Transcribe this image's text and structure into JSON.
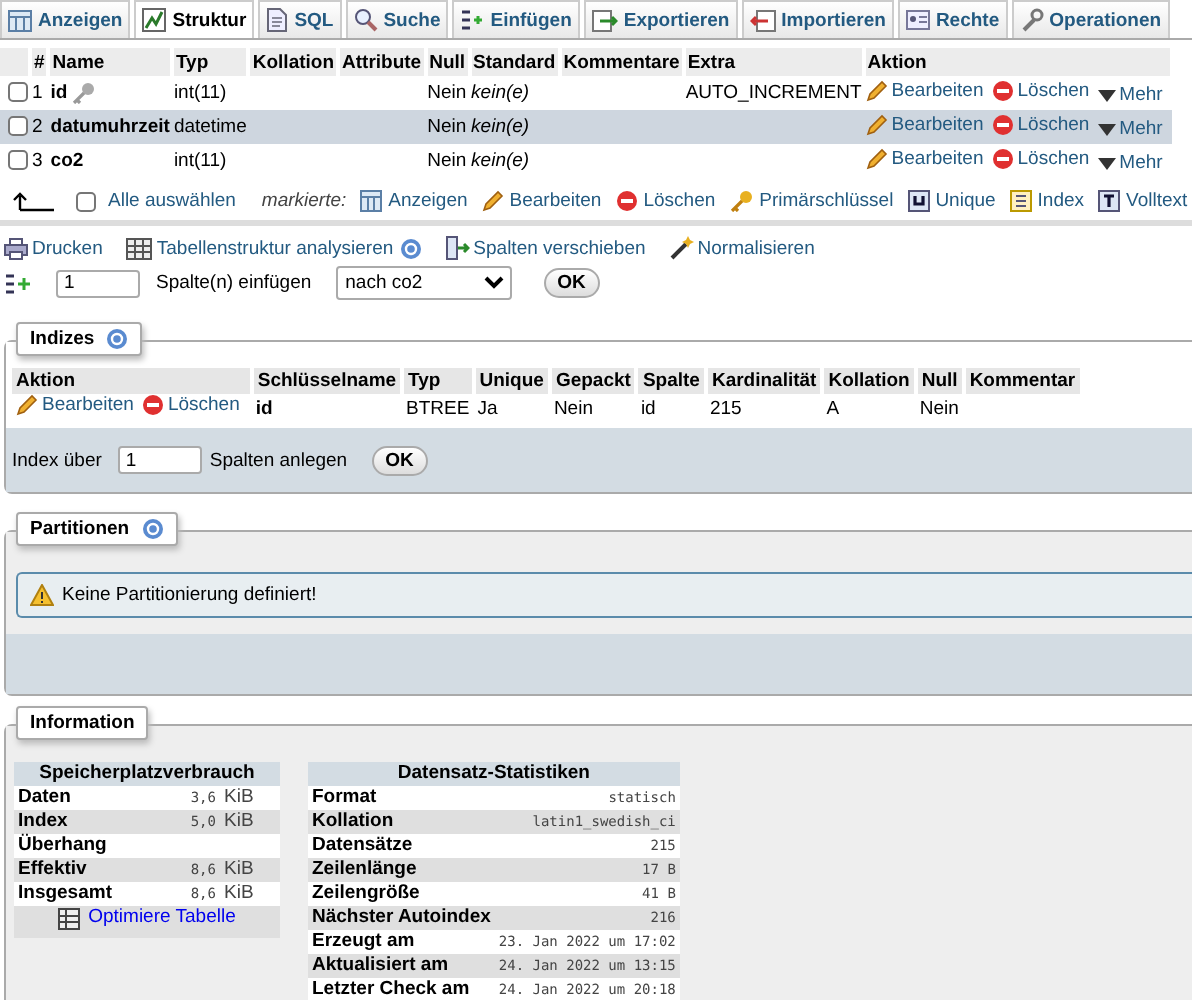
{
  "tabs": [
    {
      "label": "Anzeigen",
      "kind": "browse",
      "selected": false
    },
    {
      "label": "Struktur",
      "kind": "structure",
      "selected": true
    },
    {
      "label": "SQL",
      "kind": "sql",
      "selected": false
    },
    {
      "label": "Suche",
      "kind": "search",
      "selected": false
    },
    {
      "label": "Einfügen",
      "kind": "insert",
      "selected": false
    },
    {
      "label": "Exportieren",
      "kind": "export",
      "selected": false
    },
    {
      "label": "Importieren",
      "kind": "import",
      "selected": false
    },
    {
      "label": "Rechte",
      "kind": "privileges",
      "selected": false
    },
    {
      "label": "Operationen",
      "kind": "operations",
      "selected": false
    }
  ],
  "structure": {
    "columns": [
      "#",
      "Name",
      "Typ",
      "Kollation",
      "Attribute",
      "Null",
      "Standard",
      "Kommentare",
      "Extra",
      "Aktion"
    ],
    "rows": [
      {
        "checked": false,
        "highlighted": false,
        "number": "1",
        "name": "id",
        "primary_key": true,
        "type": "int(11)",
        "null": "Nein",
        "default": "kein(e)",
        "extra": "AUTO_INCREMENT",
        "actions": [
          "Bearbeiten",
          "Löschen",
          "Mehr"
        ]
      },
      {
        "checked": false,
        "highlighted": true,
        "number": "2",
        "name": "datumuhrzeit",
        "primary_key": false,
        "type": "datetime",
        "null": "Nein",
        "default": "kein(e)",
        "actions": [
          "Bearbeiten",
          "Löschen",
          "Mehr"
        ]
      },
      {
        "checked": false,
        "highlighted": false,
        "number": "3",
        "name": "co2",
        "primary_key": false,
        "type": "int(11)",
        "null": "Nein",
        "default": "kein(e)",
        "actions": [
          "Bearbeiten",
          "Löschen",
          "Mehr"
        ]
      }
    ]
  },
  "bulk_bar": {
    "select_all": {
      "label": "Alle auswählen",
      "checked": false
    },
    "marked_label": "markierte:",
    "buttons": [
      {
        "kind": "browse",
        "label": "Anzeigen"
      },
      {
        "kind": "edit",
        "label": "Bearbeiten"
      },
      {
        "kind": "delete",
        "label": "Löschen"
      },
      {
        "kind": "key",
        "label": "Primärschlüssel"
      },
      {
        "kind": "unique",
        "label": "Unique"
      },
      {
        "kind": "index",
        "label": "Index"
      },
      {
        "kind": "fulltext",
        "label": "Volltext"
      }
    ]
  },
  "links": [
    {
      "kind": "print",
      "label": "Drucken",
      "help": false
    },
    {
      "kind": "analyze",
      "label": "Tabellenstruktur analysieren",
      "help": true
    },
    {
      "kind": "move",
      "label": "Spalten verschieben",
      "help": false
    },
    {
      "kind": "normalize",
      "label": "Normalisieren",
      "help": false
    }
  ],
  "add_columns": {
    "count": "1",
    "label": "Spalte(n) einfügen",
    "position": "nach co2",
    "button": "OK"
  },
  "indexes": {
    "legend": "Indizes",
    "columns": [
      "Aktion",
      "Schlüsselname",
      "Typ",
      "Unique",
      "Gepackt",
      "Spalte",
      "Kardinalität",
      "Kollation",
      "Null",
      "Kommentar"
    ],
    "rows": [
      {
        "cells": [
          {
            "kind": "actions",
            "links": [
              "Bearbeiten",
              "Löschen"
            ]
          },
          {
            "kind": "key",
            "text": "id"
          },
          {
            "kind": "text",
            "text": "BTREE"
          },
          {
            "kind": "text",
            "text": "Ja"
          },
          {
            "kind": "text",
            "text": "Nein"
          },
          {
            "kind": "text",
            "text": "id"
          },
          {
            "kind": "text",
            "text": "215"
          },
          {
            "kind": "text",
            "text": "A"
          },
          {
            "kind": "text",
            "text": "Nein"
          }
        ]
      }
    ],
    "create": {
      "label": "Index über",
      "count": "1",
      "suffix": "Spalten anlegen",
      "button": "OK"
    }
  },
  "partitions": {
    "legend": "Partitionen",
    "message": "Keine Partitionierung definiert!"
  },
  "information": {
    "legend": "Information",
    "space": {
      "title": "Speicherplatzverbrauch",
      "rows": [
        {
          "label": "Daten",
          "value": "3,6",
          "unit": "KiB"
        },
        {
          "label": "Index",
          "value": "5,0",
          "unit": "KiB"
        },
        {
          "label": "Überhang"
        },
        {
          "label": "Effektiv",
          "value": "8,6",
          "unit": "KiB"
        },
        {
          "label": "Insgesamt",
          "value": "8,6",
          "unit": "KiB"
        }
      ],
      "link": "Optimiere Tabelle"
    },
    "stats": {
      "title": "Datensatz-Statistiken",
      "rows": [
        {
          "label": "Format",
          "value": "statisch"
        },
        {
          "label": "Kollation",
          "value": "latin1_swedish_ci"
        },
        {
          "label": "Datensätze",
          "value": "215"
        },
        {
          "label": "Zeilenlänge",
          "value": "17 B"
        },
        {
          "label": "Zeilengröße",
          "value": "41 B"
        },
        {
          "label": "Nächster Autoindex",
          "value": "216"
        },
        {
          "label": "Erzeugt am",
          "value": "23. Jan 2022 um 17:02"
        },
        {
          "label": "Aktualisiert am",
          "value": "24. Jan 2022 um 13:15"
        },
        {
          "label": "Letzter Check am",
          "value": "24. Jan 2022 um 20:18"
        }
      ]
    }
  }
}
